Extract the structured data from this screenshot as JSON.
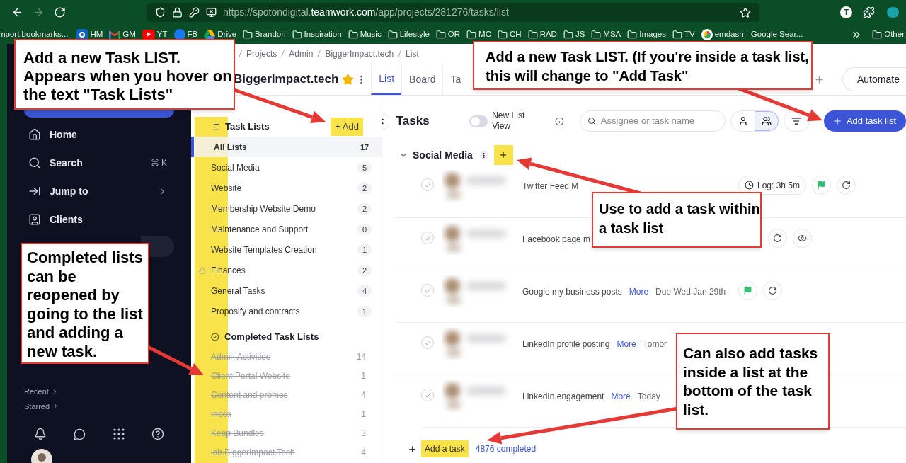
{
  "browser": {
    "nav": [
      {
        "kind": "back",
        "disabled": false
      },
      {
        "kind": "forward",
        "disabled": true
      },
      {
        "kind": "reload",
        "disabled": false
      }
    ],
    "url": {
      "scheme": "https://spotondigital.",
      "domain": "teamwork.com",
      "path": "/app/projects/281276/tasks/list"
    },
    "profile": "T",
    "bookmarks": [
      {
        "label": "mport bookmarks...",
        "kind": "none"
      },
      {
        "label": "HM",
        "kind": "outlook"
      },
      {
        "label": "GM",
        "kind": "gmail"
      },
      {
        "label": "YT",
        "kind": "youtube"
      },
      {
        "label": "FB",
        "kind": "facebook"
      },
      {
        "label": "Drive",
        "kind": "drive"
      },
      {
        "label": "Brandon",
        "kind": "folder"
      },
      {
        "label": "Inspiration",
        "kind": "folder"
      },
      {
        "label": "Music",
        "kind": "folder"
      },
      {
        "label": "Lifestyle",
        "kind": "folder"
      },
      {
        "label": "OR",
        "kind": "folder"
      },
      {
        "label": "MC",
        "kind": "folder"
      },
      {
        "label": "CH",
        "kind": "folder"
      },
      {
        "label": "RAD",
        "kind": "folder"
      },
      {
        "label": "JS",
        "kind": "folder"
      },
      {
        "label": "MSA",
        "kind": "folder"
      },
      {
        "label": "Images",
        "kind": "folder"
      },
      {
        "label": "TV",
        "kind": "folder"
      },
      {
        "label": "emdash - Google Sear...",
        "kind": "google"
      }
    ],
    "other": "Other"
  },
  "sidebar": {
    "items": [
      {
        "label": "Home",
        "kind": "home",
        "submenu": false
      },
      {
        "label": "Search",
        "kind": "search",
        "shortcut": "⌘ K",
        "submenu": false
      },
      {
        "label": "Jump to",
        "kind": "jump",
        "submenu": true
      },
      {
        "label": "Clients",
        "kind": "clients",
        "submenu": false
      }
    ],
    "links": [
      "Recent",
      "Starred"
    ]
  },
  "breadcrumb": [
    "Projects",
    "Admin",
    "BiggerImpact.tech",
    "List"
  ],
  "project": {
    "title": "BiggerImpact.tech",
    "starred": true
  },
  "tabs": [
    {
      "label": "List",
      "selected": true
    },
    {
      "label": "Board",
      "selected": false
    },
    {
      "label": "Ta",
      "selected": false
    }
  ],
  "automate": "Automate",
  "task_lists": {
    "title": "Task Lists",
    "add": "+ Add",
    "lists": [
      {
        "name": "All Lists",
        "count": "17",
        "selected": true,
        "locked": false
      },
      {
        "name": "Social Media",
        "count": "5",
        "selected": false,
        "locked": false
      },
      {
        "name": "Website",
        "count": "2",
        "selected": false,
        "locked": false
      },
      {
        "name": "Membership Website Demo",
        "count": "2",
        "selected": false,
        "locked": false
      },
      {
        "name": "Maintenance and Support",
        "count": "0",
        "selected": false,
        "locked": false
      },
      {
        "name": "Website Templates Creation",
        "count": "1",
        "selected": false,
        "locked": false
      },
      {
        "name": "Finances",
        "count": "2",
        "selected": false,
        "locked": true
      },
      {
        "name": "General Tasks",
        "count": "4",
        "selected": false,
        "locked": false
      },
      {
        "name": "Proposify and contracts",
        "count": "1",
        "selected": false,
        "locked": false
      }
    ],
    "completed_title": "Completed Task Lists",
    "completed": [
      {
        "name": "Admin Activities",
        "count": "14"
      },
      {
        "name": "Client Portal Website",
        "count": "1"
      },
      {
        "name": "Content and promos",
        "count": "4"
      },
      {
        "name": "Inbox",
        "count": "1"
      },
      {
        "name": "Keap Bundles",
        "count": "3"
      },
      {
        "name": "lab.BiggerImpact.Tech",
        "count": "4"
      }
    ]
  },
  "tasks": {
    "title": "Tasks",
    "toggle": {
      "label": "New List View",
      "on": false
    },
    "search_placeholder": "Assignee or task name",
    "view": [
      {
        "kind": "user",
        "selected": false
      },
      {
        "kind": "users",
        "selected": true
      }
    ],
    "add_button": "Add task list",
    "group": {
      "name": "Social Media",
      "expanded": true,
      "rows": [
        {
          "title": "Twitter Feed M",
          "done": false,
          "log": "Log: 3h 5m",
          "flag": true,
          "repeat": true,
          "watch": false
        },
        {
          "title": "Facebook page m",
          "done": false,
          "flag": false,
          "repeat": true,
          "watch": true
        },
        {
          "title": "Google my business posts",
          "done": false,
          "more": "More",
          "due": "Due Wed Jan 29th",
          "flag": true,
          "repeat": true,
          "watch": false
        },
        {
          "title": "LinkedIn profile posting",
          "done": false,
          "more": "More",
          "due": "Tomor"
        },
        {
          "title": "LinkedIn engagement",
          "done": false,
          "more": "More",
          "due": "Today"
        }
      ]
    },
    "add_task": "Add a task",
    "completed": "4876 completed"
  },
  "callouts": [
    {
      "text": "Add a new Task LIST. Appears when you hover on the text \"Task Lists\""
    },
    {
      "text": "Add a new Task LIST. (If you're inside a task list, this will change to \"Add Task\""
    },
    {
      "text": "Completed lists can be reopened by going to the list and adding a new task."
    },
    {
      "text": "Use to add a task within a task list"
    },
    {
      "text": "Can also add tasks inside a list at the bottom of the task list."
    }
  ]
}
